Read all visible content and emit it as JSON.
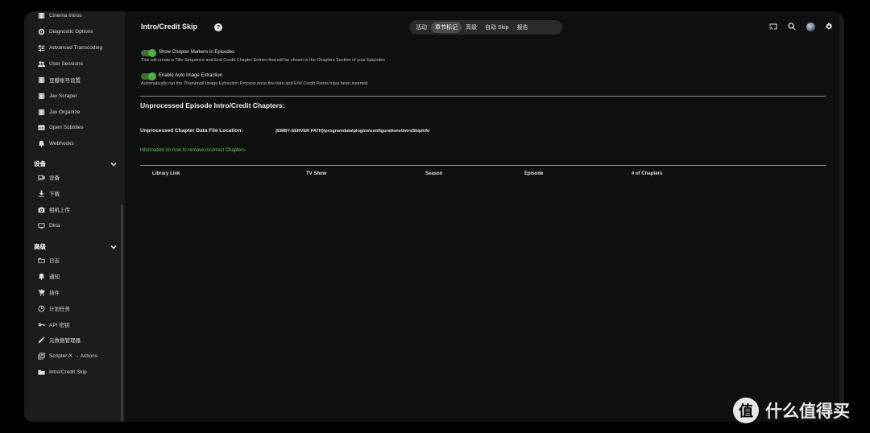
{
  "sidebar": {
    "top_items": [
      {
        "label": "Cinema Intros",
        "icon": "film-icon"
      },
      {
        "label": "Diagnostic Options",
        "icon": "diagnostic-icon"
      },
      {
        "label": "Advanced Transcoding",
        "icon": "sliders-icon"
      },
      {
        "label": "User Sessions",
        "icon": "people-icon"
      },
      {
        "label": "豆瓣账号设置",
        "icon": "film-icon"
      },
      {
        "label": "Jav Scraper",
        "icon": "film-icon"
      },
      {
        "label": "Jav Organize",
        "icon": "film-icon"
      },
      {
        "label": "Open Subtitles",
        "icon": "subtitles-icon"
      },
      {
        "label": "Webhooks",
        "icon": "bell-icon"
      }
    ],
    "devices_title": "设备",
    "device_items": [
      {
        "label": "设备",
        "icon": "devices-icon"
      },
      {
        "label": "下载",
        "icon": "download-icon"
      },
      {
        "label": "相机上传",
        "icon": "camera-icon"
      },
      {
        "label": "Dlna",
        "icon": "dlna-icon"
      }
    ],
    "advanced_title": "高级",
    "advanced_items": [
      {
        "label": "日志",
        "icon": "folder-icon"
      },
      {
        "label": "通知",
        "icon": "bell-icon"
      },
      {
        "label": "插件",
        "icon": "cart-icon"
      },
      {
        "label": "计划任务",
        "icon": "clock-icon"
      },
      {
        "label": "API 密钥",
        "icon": "key-icon"
      },
      {
        "label": "元数据管理器",
        "icon": "pencil-icon"
      },
      {
        "label": "Scripter-X → Actions",
        "icon": "library-icon"
      },
      {
        "label": "Intro/Credit Skip",
        "icon": "folder-icon"
      }
    ]
  },
  "header": {
    "title": "Intro/Credit Skip",
    "tabs": [
      "活动",
      "章节标记",
      "高级",
      "自动 Skip",
      "报告"
    ],
    "active_tab": "章节标记"
  },
  "settings": {
    "chapter_markers_label": "Show Chapter Markers in Episodes",
    "chapter_markers_desc": "This will create a Title Sequence and End Credit Chapter Entries that will be shown in the Chapters Section of your Episodes",
    "chapter_markers_enabled": true,
    "image_extraction_label": "Enable Auto Image Extraction",
    "image_extraction_desc": "Automatically run the Thumbnail Image Extraction Process once the Intro and End Credit Points have been inserted.",
    "image_extraction_enabled": true
  },
  "unprocessed": {
    "heading": "Unprocessed Episode Intro/Credit Chapters:",
    "location_label": "Unprocessed Chapter Data File Location:",
    "location_value": "{EMBY-SERVER PATH}\\programdata\\plugins\\configurations\\IntroSkipInfo",
    "info_link": "Information on how to remove incorrect Chapters.",
    "columns": [
      "Library Link",
      "TV Show",
      "Season",
      "Episode",
      "# of Chapters"
    ]
  },
  "colors": {
    "accent": "#52b043",
    "link": "#5fcf53",
    "background": "#101010",
    "sidebar": "#1c1c1c"
  },
  "watermark": {
    "badge": "值",
    "text": "什么值得买"
  }
}
